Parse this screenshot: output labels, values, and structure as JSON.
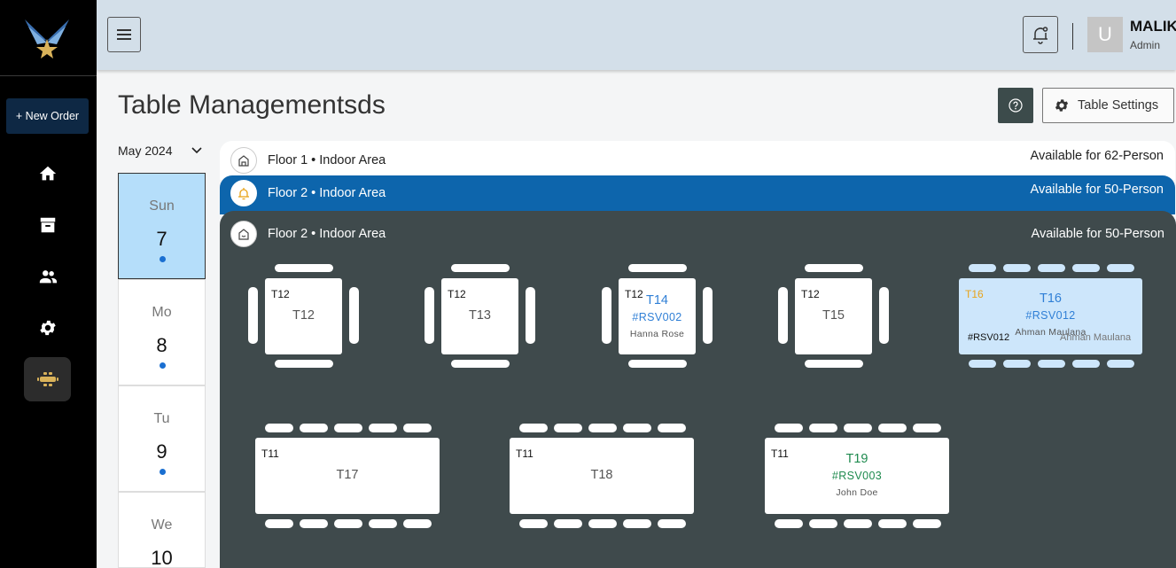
{
  "sidebar": {
    "new_order_label": "+ New Order",
    "nav": [
      "home-icon",
      "archive-icon",
      "people-icon",
      "gear-icon",
      "table-icon"
    ]
  },
  "topbar": {
    "user_initial": "U",
    "user_name": "MALIK",
    "user_role": "Admin"
  },
  "page": {
    "title": "Table Managementsds",
    "settings_label": "Table Settings"
  },
  "calendar": {
    "month": "May 2024",
    "days": [
      {
        "name": "Sun",
        "num": "7"
      },
      {
        "name": "Mo",
        "num": "8"
      },
      {
        "name": "Tu",
        "num": "9"
      },
      {
        "name": "We",
        "num": "10"
      }
    ]
  },
  "floors": [
    {
      "title": "Floor 1 • Indoor Area",
      "available": "Available for 62-Person"
    },
    {
      "title": "Floor 2 • Indoor Area",
      "available": "Available for 50-Person"
    },
    {
      "title": "Floor 2 • Indoor Area",
      "available": "Available for 50-Person"
    }
  ],
  "tables": {
    "t12": {
      "tag": "T12",
      "name": "T12"
    },
    "t13": {
      "tag": "T12",
      "name": "T13"
    },
    "t14": {
      "tag": "T12",
      "name": "T14",
      "rsv": "#RSV002",
      "guest": "Hanna Rose"
    },
    "t15": {
      "tag": "T12",
      "name": "T15"
    },
    "t16": {
      "tag": "T16",
      "name": "T16",
      "rsv": "#RSV012",
      "guest": "Ahman Maulana",
      "rsv2": "#RSV012",
      "guest2": "Ahman Maulana"
    },
    "t17": {
      "tag": "T11",
      "name": "T17"
    },
    "t18": {
      "tag": "T11",
      "name": "T18"
    },
    "t19": {
      "tag": "T11",
      "name": "T19",
      "rsv": "#RSV003",
      "guest": "John Doe"
    }
  },
  "colors": {
    "sidebar": "#000000",
    "topbar": "#d3dfe9",
    "floor_active": "#0d65ac",
    "floor_main": "#3f4a4c",
    "selected_day": "#b5defa",
    "reserved_blue": "#2f7fd6",
    "reserved_green": "#1e8a4e",
    "tag_orange": "#e8a31a"
  }
}
